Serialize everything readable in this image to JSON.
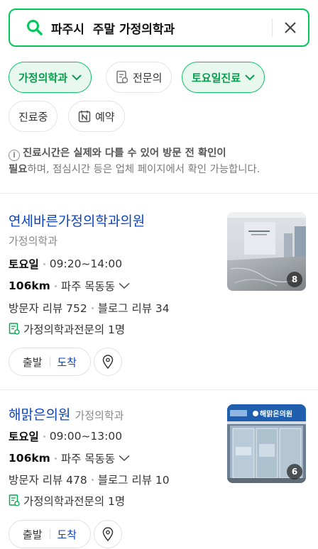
{
  "search": {
    "query": "파주시  주말 가정의학과",
    "search_icon": "search-icon",
    "clear_icon": "close-icon",
    "accent": "#03c75a"
  },
  "filters": [
    {
      "label": "가정의학과",
      "active": true
    },
    {
      "label": "전문의",
      "active": false,
      "icon": "doctor-document-icon"
    },
    {
      "label": "토요일진료",
      "active": true
    },
    {
      "label": "진료중",
      "active": false
    },
    {
      "label": "예약",
      "active": false,
      "icon": "n-booking-icon"
    }
  ],
  "notice": {
    "bold1": "진료시간은 실제와 다를 수 있어 방문 전 확인이",
    "bold2": "필요",
    "rest": "하며, 점심시간 등은 업체 페이지에서 확인 가능합니다."
  },
  "places": [
    {
      "name": "연세바른가정의학과의원",
      "category": "가정의학과",
      "day": "토요일",
      "hours": "09:20~14:00",
      "distance": "106km",
      "area": "파주 목동동",
      "visitor_reviews": "방문자 리뷰 752",
      "blog_reviews": "블로그 리뷰 34",
      "specialist": "가정의학과전문의 1명",
      "photo_count": "8",
      "start_label": "출발",
      "arrive_label": "도착"
    },
    {
      "name": "해맑은의원",
      "category": "가정의학과",
      "day": "토요일",
      "hours": "09:00~13:00",
      "distance": "106km",
      "area": "파주 목동동",
      "visitor_reviews": "방문자 리뷰 478",
      "blog_reviews": "블로그 리뷰 10",
      "specialist": "가정의학과전문의 1명",
      "photo_count": "6",
      "sign_text": "해맑은의원",
      "start_label": "출발",
      "arrive_label": "도착"
    }
  ]
}
